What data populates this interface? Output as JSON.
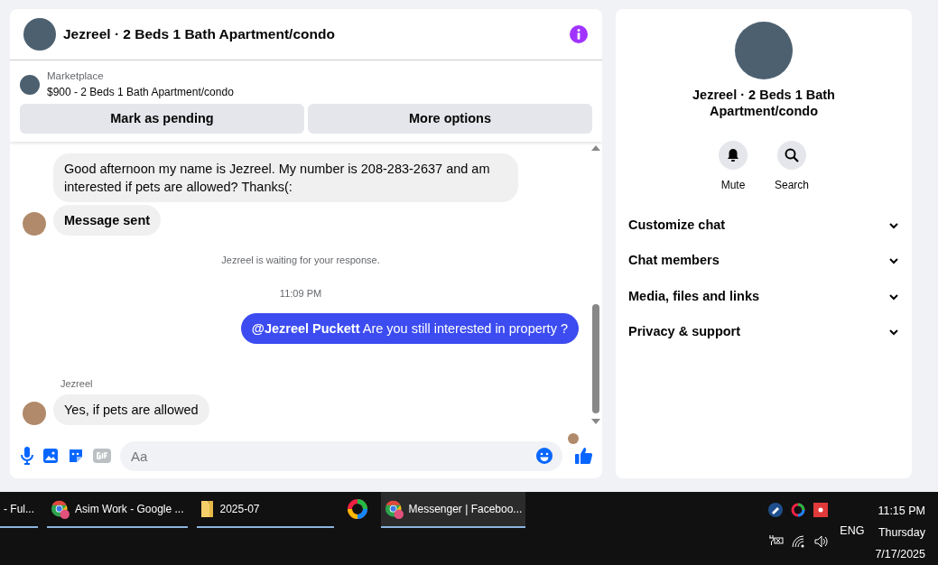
{
  "header": {
    "title": "Jezreel · 2 Beds 1 Bath Apartment/condo"
  },
  "listing": {
    "source": "Marketplace",
    "title": "$900 - 2 Beds 1 Bath Apartment/condo"
  },
  "actions": [
    "Mark as pending",
    "More options"
  ],
  "messages": [
    {
      "kind": "incoming",
      "text": "Good afternoon my name is Jezreel. My number is 208-283-2637 and am interested if pets are allowed? Thanks(:",
      "avatar": false,
      "emphasis": false
    },
    {
      "kind": "incoming",
      "text": "Message sent",
      "avatar": true,
      "emphasis": true
    },
    {
      "kind": "notice",
      "text": "Jezreel is waiting for your response."
    },
    {
      "kind": "time",
      "text": "11:09 PM"
    },
    {
      "kind": "outgoing",
      "text": "**@Jezreel Puckett** Are you still interested in property ?"
    },
    {
      "kind": "sender",
      "text": "Jezreel"
    },
    {
      "kind": "incoming",
      "text": "Yes, if pets are allowed",
      "avatar": true,
      "emphasis": false
    }
  ],
  "composer": {
    "placeholder": "Aa"
  },
  "details": {
    "title": "Jezreel · 2 Beds 1 Bath Apartment/condo",
    "quick_actions": [
      {
        "label": "Mute"
      },
      {
        "label": "Search"
      }
    ],
    "sections": [
      {
        "label": "Customize chat",
        "expanded": false
      },
      {
        "label": "Chat members",
        "expanded": false
      },
      {
        "label": "Media, files and links",
        "expanded": false
      },
      {
        "label": "Privacy & support",
        "expanded": false
      }
    ]
  },
  "taskbar": {
    "items": [
      {
        "kind": "window",
        "label": "- Ful...",
        "selected": false
      },
      {
        "kind": "browser",
        "label": "Asim Work - Google ...",
        "selected": false
      },
      {
        "kind": "folder",
        "label": "2025-07",
        "selected": false
      },
      {
        "kind": "pinned",
        "selected": false
      },
      {
        "kind": "browser",
        "label": "Messenger | Faceboo...",
        "selected": true
      }
    ],
    "language": "ENG",
    "time": "11:15 PM",
    "day": "Thursday",
    "date": "7/17/2025"
  }
}
